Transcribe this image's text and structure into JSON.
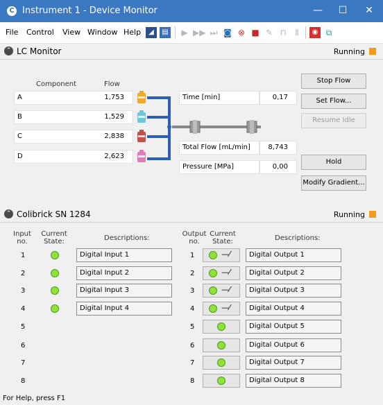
{
  "window": {
    "title": "Instrument 1 - Device Monitor"
  },
  "menu": [
    "File",
    "Control",
    "View",
    "Window",
    "Help"
  ],
  "lc": {
    "title": "LC Monitor",
    "status": "Running",
    "col_component": "Component",
    "col_flow": "Flow",
    "rows": [
      {
        "name": "A",
        "flow": "1,753",
        "color": "#f0a92b"
      },
      {
        "name": "B",
        "flow": "1,529",
        "color": "#6fc6d8"
      },
      {
        "name": "C",
        "flow": "2,838",
        "color": "#c0504d"
      },
      {
        "name": "D",
        "flow": "2,623",
        "color": "#e07bb8"
      }
    ],
    "time_label": "Time [min]",
    "time_value": "0,17",
    "total_flow_label": "Total Flow [mL/min]",
    "total_flow_value": "8,743",
    "pressure_label": "Pressure [MPa]",
    "pressure_value": "0,00",
    "buttons": {
      "stop_flow": "Stop Flow",
      "set_flow": "Set Flow...",
      "resume_idle": "Resume Idle",
      "hold": "Hold",
      "modify_gradient": "Modify Gradient..."
    }
  },
  "colibrick": {
    "title": "Colibrick SN 1284",
    "status": "Running",
    "input_no": "Input no.",
    "input_state": "Current State:",
    "input_desc": "Descriptions:",
    "output_no": "Output no.",
    "output_state": "Current State:",
    "output_desc": "Descriptions:",
    "inputs": [
      {
        "no": "1",
        "desc": "Digital Input 1"
      },
      {
        "no": "2",
        "desc": "Digital Input 2"
      },
      {
        "no": "3",
        "desc": "Digital Input 3"
      },
      {
        "no": "4",
        "desc": "Digital Input 4"
      },
      {
        "no": "5",
        "desc": ""
      },
      {
        "no": "6",
        "desc": ""
      },
      {
        "no": "7",
        "desc": ""
      },
      {
        "no": "8",
        "desc": ""
      }
    ],
    "outputs": [
      {
        "no": "1",
        "desc": "Digital Output 1"
      },
      {
        "no": "2",
        "desc": "Digital Output 2"
      },
      {
        "no": "3",
        "desc": "Digital Output 3"
      },
      {
        "no": "4",
        "desc": "Digital Output 4"
      },
      {
        "no": "5",
        "desc": "Digital Output 5"
      },
      {
        "no": "6",
        "desc": "Digital Output 6"
      },
      {
        "no": "7",
        "desc": "Digital Output 7"
      },
      {
        "no": "8",
        "desc": "Digital Output 8"
      }
    ]
  },
  "statusbar": {
    "text": "For Help, press F1"
  }
}
